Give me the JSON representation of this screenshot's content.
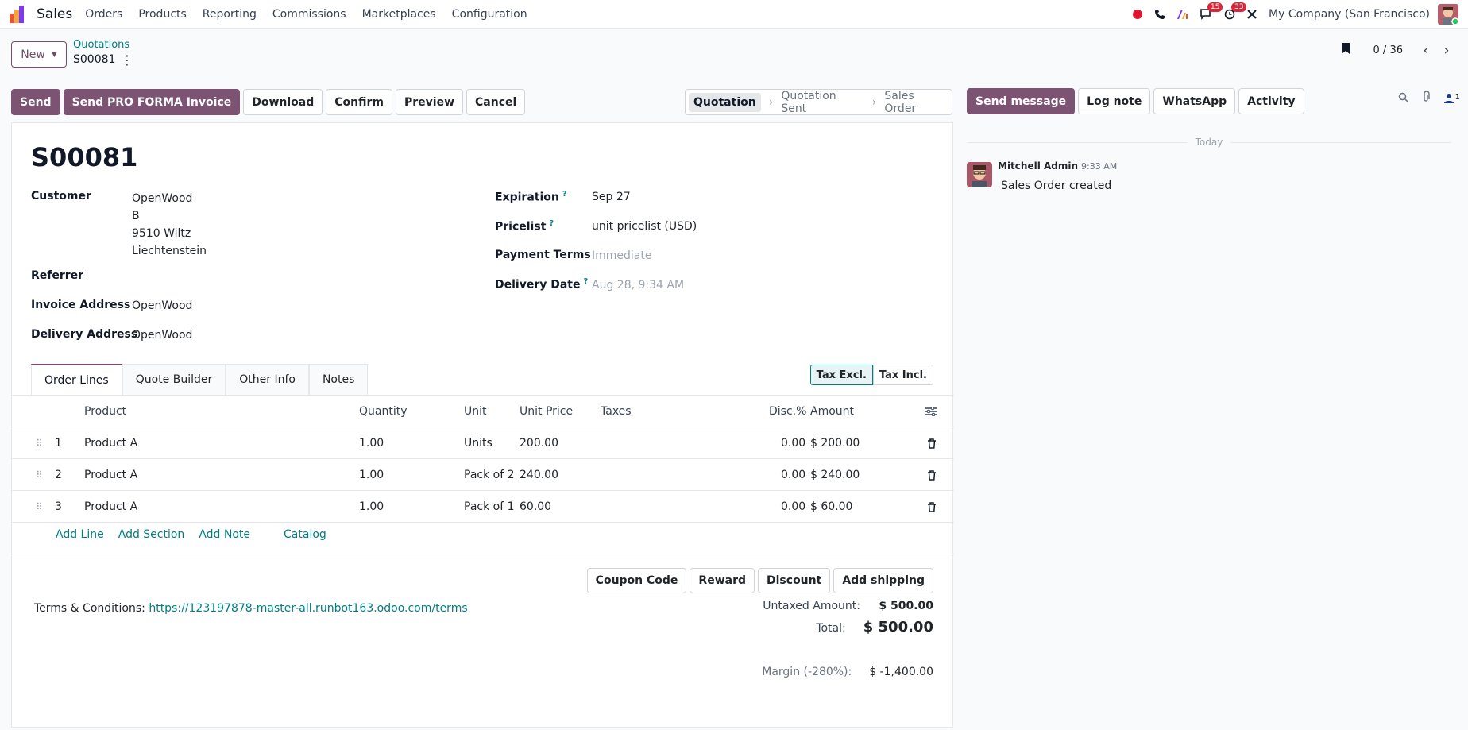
{
  "navbar": {
    "app_title": "Sales",
    "menu": [
      "Orders",
      "Products",
      "Reporting",
      "Commissions",
      "Marketplaces",
      "Configuration"
    ],
    "messages_count": "15",
    "activities_count": "33",
    "company": "My Company (San Francisco)"
  },
  "control_panel": {
    "new_label": "New",
    "breadcrumb_parent": "Quotations",
    "breadcrumb_current": "S00081",
    "pager": "0 / 36"
  },
  "actions": {
    "send": "Send",
    "send_proforma": "Send PRO FORMA Invoice",
    "download": "Download",
    "confirm": "Confirm",
    "preview": "Preview",
    "cancel": "Cancel"
  },
  "statusbar": {
    "stages": [
      "Quotation",
      "Quotation Sent",
      "Sales Order"
    ],
    "current": "Quotation"
  },
  "form": {
    "name": "S00081",
    "customer_label": "Customer",
    "customer_lines": [
      "OpenWood",
      "B",
      "9510 Wiltz",
      "Liechtenstein"
    ],
    "referrer_label": "Referrer",
    "invoice_address_label": "Invoice Address",
    "invoice_address": "OpenWood",
    "delivery_address_label": "Delivery Address",
    "delivery_address": "OpenWood",
    "expiration_label": "Expiration",
    "expiration": "Sep 27",
    "pricelist_label": "Pricelist",
    "pricelist": "unit pricelist (USD)",
    "payment_terms_label": "Payment Terms",
    "payment_terms_placeholder": "Immediate",
    "delivery_date_label": "Delivery Date",
    "delivery_date_placeholder": "Aug 28, 9:34 AM"
  },
  "tabs": [
    "Order Lines",
    "Quote Builder",
    "Other Info",
    "Notes"
  ],
  "tax_toggle": {
    "excl": "Tax Excl.",
    "incl": "Tax Incl."
  },
  "order_lines": {
    "columns": {
      "product": "Product",
      "quantity": "Quantity",
      "unit": "Unit",
      "unit_price": "Unit Price",
      "taxes": "Taxes",
      "discount": "Disc.%",
      "amount": "Amount"
    },
    "rows": [
      {
        "seq": "1",
        "product": "Product A",
        "quantity": "1.00",
        "unit": "Units",
        "unit_price": "200.00",
        "discount": "0.00",
        "amount": "$ 200.00"
      },
      {
        "seq": "2",
        "product": "Product A",
        "quantity": "1.00",
        "unit": "Pack of 2",
        "unit_price": "240.00",
        "discount": "0.00",
        "amount": "$ 240.00"
      },
      {
        "seq": "3",
        "product": "Product A",
        "quantity": "1.00",
        "unit": "Pack of 1",
        "unit_price": "60.00",
        "discount": "0.00",
        "amount": "$ 60.00"
      }
    ],
    "add_line": "Add Line",
    "add_section": "Add Section",
    "add_note": "Add Note",
    "catalog": "Catalog"
  },
  "extra_buttons": {
    "coupon": "Coupon Code",
    "reward": "Reward",
    "discount": "Discount",
    "shipping": "Add shipping"
  },
  "terms": {
    "label": "Terms & Conditions:",
    "url": "https://123197878-master-all.runbot163.odoo.com/terms"
  },
  "totals": {
    "untaxed_label": "Untaxed Amount:",
    "untaxed": "$ 500.00",
    "total_label": "Total:",
    "total": "$ 500.00",
    "margin_label": "Margin (-280%):",
    "margin": "$ -1,400.00"
  },
  "chatter": {
    "send_message": "Send message",
    "log_note": "Log note",
    "whatsapp": "WhatsApp",
    "activity": "Activity",
    "followers_count": "1",
    "today": "Today",
    "author": "Mitchell Admin",
    "time": "9:33 AM",
    "body": "Sales Order created"
  },
  "colors": {
    "brand": "#714b67",
    "link": "#017e84",
    "badge": "#d9273c"
  }
}
